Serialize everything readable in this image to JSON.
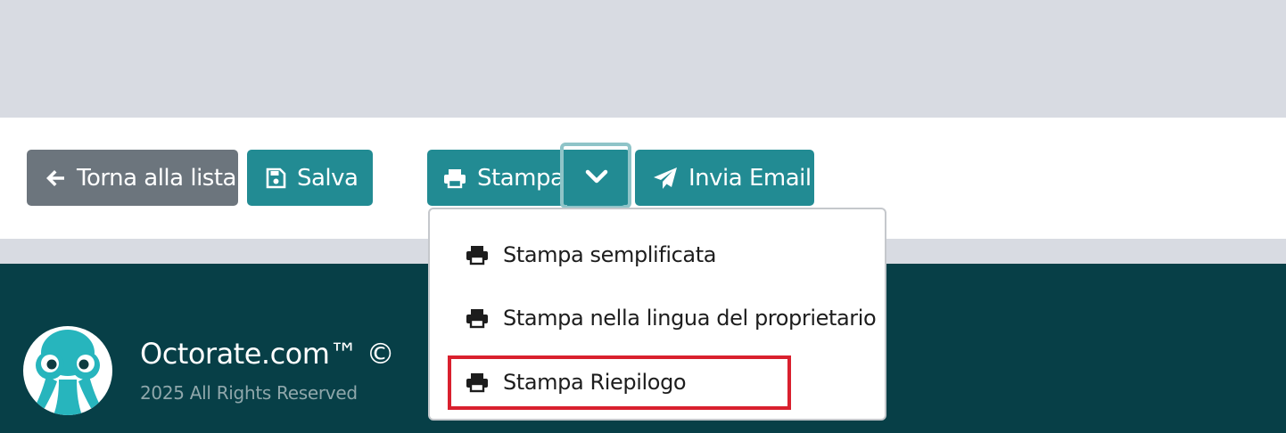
{
  "toolbar": {
    "back_label": "Torna alla lista",
    "save_label": "Salva",
    "print_label": "Stampa",
    "email_label": "Invia Email"
  },
  "print_menu": {
    "items": [
      {
        "label": "Stampa semplificata",
        "icon": "printer-icon"
      },
      {
        "label": "Stampa nella lingua del proprietario",
        "icon": "printer-icon"
      },
      {
        "label": "Stampa Riepilogo",
        "icon": "printer-icon",
        "highlighted": true
      }
    ]
  },
  "footer": {
    "brand": "Octorate.com™ ©",
    "rights": "2025 All Rights Reserved"
  },
  "colors": {
    "primary": "#228b93",
    "secondary": "#6c757d",
    "footer_bg": "#073f47",
    "page_bg": "#d8dbe2",
    "highlight": "#d9202e"
  }
}
